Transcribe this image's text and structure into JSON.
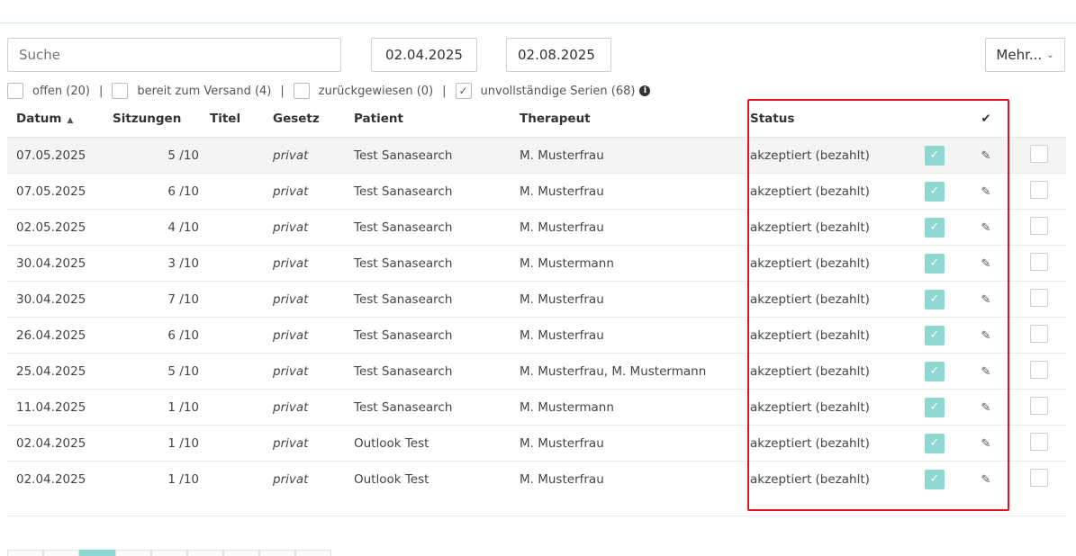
{
  "search": {
    "placeholder": "Suche"
  },
  "date_from": "02.04.2025",
  "date_to": "02.08.2025",
  "more_button": "Mehr...",
  "filters": [
    {
      "label": "offen (20)",
      "checked": false
    },
    {
      "label": "bereit zum Versand (4)",
      "checked": false
    },
    {
      "label": "zurückgewiesen (0)",
      "checked": false
    },
    {
      "label": "unvollständige Serien (68)",
      "checked": true
    }
  ],
  "columns": {
    "datum": "Datum",
    "sitzungen": "Sitzungen",
    "titel": "Titel",
    "gesetz": "Gesetz",
    "patient": "Patient",
    "therapeut": "Therapeut",
    "status": "Status"
  },
  "rows": [
    {
      "datum": "07.05.2025",
      "sitzungen": "5 /10",
      "gesetz": "privat",
      "patient": "Test Sanasearch",
      "therapeut": "M. Musterfrau",
      "status": "akzeptiert (bezahlt)"
    },
    {
      "datum": "07.05.2025",
      "sitzungen": "6 /10",
      "gesetz": "privat",
      "patient": "Test Sanasearch",
      "therapeut": "M. Musterfrau",
      "status": "akzeptiert (bezahlt)"
    },
    {
      "datum": "02.05.2025",
      "sitzungen": "4 /10",
      "gesetz": "privat",
      "patient": "Test Sanasearch",
      "therapeut": "M. Musterfrau",
      "status": "akzeptiert (bezahlt)"
    },
    {
      "datum": "30.04.2025",
      "sitzungen": "3 /10",
      "gesetz": "privat",
      "patient": "Test Sanasearch",
      "therapeut": "M. Mustermann",
      "status": "akzeptiert (bezahlt)"
    },
    {
      "datum": "30.04.2025",
      "sitzungen": "7 /10",
      "gesetz": "privat",
      "patient": "Test Sanasearch",
      "therapeut": "M. Musterfrau",
      "status": "akzeptiert (bezahlt)"
    },
    {
      "datum": "26.04.2025",
      "sitzungen": "6 /10",
      "gesetz": "privat",
      "patient": "Test Sanasearch",
      "therapeut": "M. Musterfrau",
      "status": "akzeptiert (bezahlt)"
    },
    {
      "datum": "25.04.2025",
      "sitzungen": "5 /10",
      "gesetz": "privat",
      "patient": "Test Sanasearch",
      "therapeut": "M. Musterfrau, M. Mustermann",
      "status": "akzeptiert (bezahlt)"
    },
    {
      "datum": "11.04.2025",
      "sitzungen": "1 /10",
      "gesetz": "privat",
      "patient": "Test Sanasearch",
      "therapeut": "M. Mustermann",
      "status": "akzeptiert (bezahlt)"
    },
    {
      "datum": "02.04.2025",
      "sitzungen": "1 /10",
      "gesetz": "privat",
      "patient": "Outlook Test",
      "therapeut": "M. Musterfrau",
      "status": "akzeptiert (bezahlt)"
    },
    {
      "datum": "02.04.2025",
      "sitzungen": "1 /10",
      "gesetz": "privat",
      "patient": "Outlook Test",
      "therapeut": "M. Musterfrau",
      "status": "akzeptiert (bezahlt)"
    }
  ],
  "colors": {
    "status_accepted": "#7cb97a",
    "check_box": "#8fd8d2",
    "highlight_border": "#e0141e"
  },
  "icons": {
    "sort": "sort-ascending-icon",
    "check_column": "checkmark-icon",
    "edit": "edit-icon",
    "info": "info-icon"
  }
}
